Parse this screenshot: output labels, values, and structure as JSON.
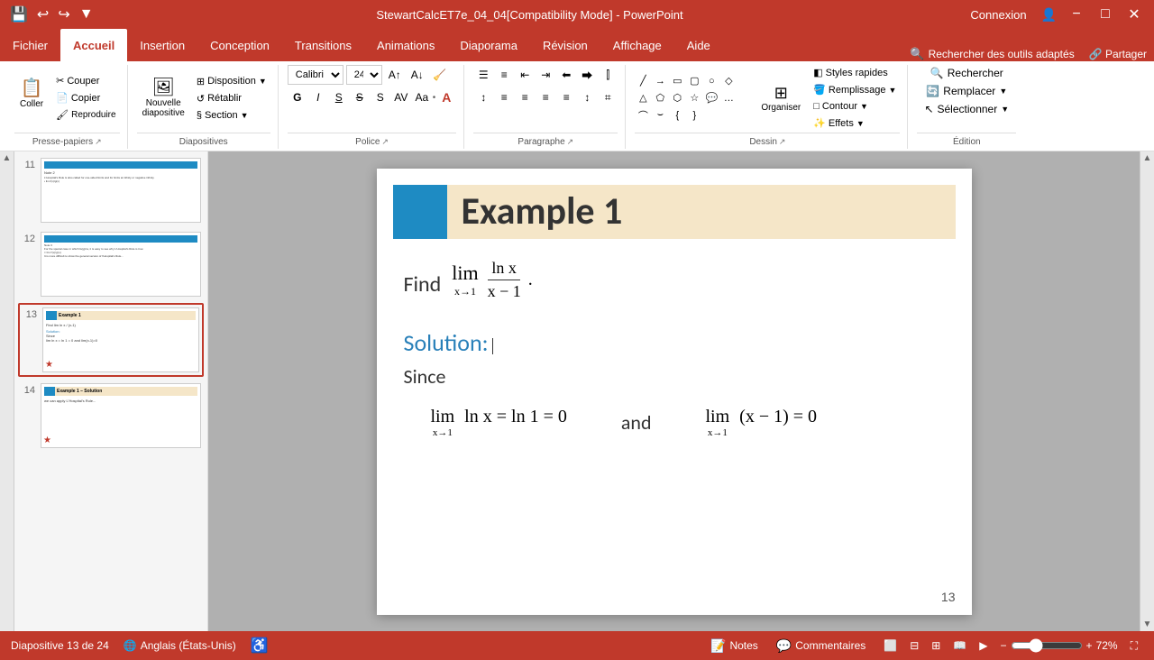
{
  "titlebar": {
    "title": "StewartCalcET7e_04_04[Compatibility Mode] - PowerPoint",
    "connexion_label": "Connexion",
    "min_label": "−",
    "max_label": "□",
    "close_label": "✕"
  },
  "quickaccess": {
    "save": "💾",
    "undo": "↩",
    "redo": "↪",
    "customize": "▼"
  },
  "ribbon": {
    "tabs": [
      "Fichier",
      "Accueil",
      "Insertion",
      "Conception",
      "Transitions",
      "Animations",
      "Diaporama",
      "Révision",
      "Affichage",
      "Aide"
    ],
    "active_tab": "Accueil",
    "groups": {
      "presse_papiers": "Presse-papiers",
      "diapositives": "Diapositives",
      "police": "Police",
      "paragraphe": "Paragraphe",
      "dessin": "Dessin",
      "edition": "Édition"
    },
    "buttons": {
      "coller": "Coller",
      "nouvelle_diapositive": "Nouvelle\ndiapositive",
      "disposition": "Disposition",
      "retablir": "Rétablir",
      "section": "Section",
      "organiser": "Organiser",
      "styles_rapides": "Styles\nrapides",
      "rechercher": "Rechercher",
      "remplacer": "Remplacer",
      "selectionner": "Sélectionner",
      "remplissage": "Remplissage",
      "contour": "Contour",
      "effets": "Effets"
    }
  },
  "slides": [
    {
      "num": "11",
      "active": false,
      "star": false,
      "label": "Indeterminate Forms / Hospital"
    },
    {
      "num": "12",
      "active": false,
      "star": false,
      "label": "Indeterminate Forms / Hospital"
    },
    {
      "num": "13",
      "active": true,
      "star": true,
      "label": "Example 1"
    },
    {
      "num": "14",
      "active": false,
      "star": true,
      "label": "Example 1 – Solution"
    }
  ],
  "slide": {
    "title": "Example 1",
    "find_text": "Find",
    "lim_sub_find": "x→1",
    "fraction_num": "ln x",
    "fraction_den": "x − 1",
    "period": ".",
    "solution_label": "Solution:",
    "since_text": "Since",
    "lim1_sub": "x→1",
    "lim1_expr": "ln x = ln 1 = 0",
    "and_text": "and",
    "lim2_sub": "x→1",
    "lim2_expr": "(x − 1) = 0",
    "page_num": "13"
  },
  "statusbar": {
    "slide_info": "Diapositive 13 de 24",
    "language": "Anglais (États-Unis)",
    "notes_label": "Notes",
    "comments_label": "Commentaires",
    "zoom_level": "72%",
    "view_icons": [
      "normal",
      "outline",
      "slidesorter",
      "reading",
      "slideshow"
    ]
  }
}
